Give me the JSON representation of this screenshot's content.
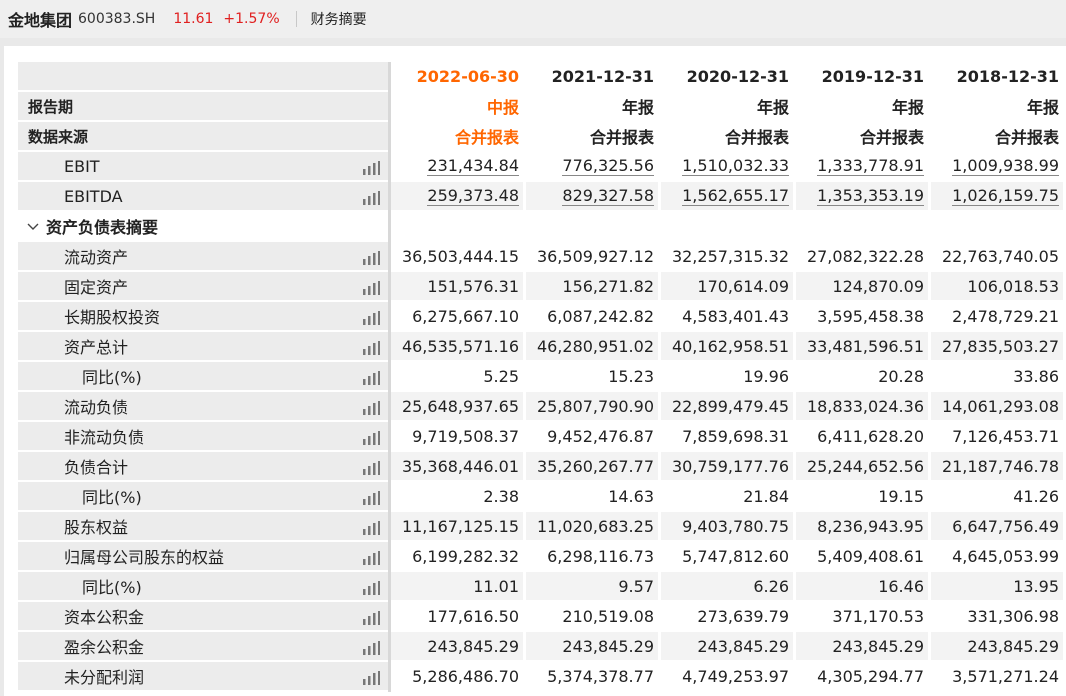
{
  "header": {
    "company": "金地集团",
    "code": "600383.SH",
    "price": "11.61",
    "change": "+1.57%",
    "tab": "财务摘要"
  },
  "columns": [
    {
      "date": "2022-06-30",
      "type": "中报",
      "source": "合并报表"
    },
    {
      "date": "2021-12-31",
      "type": "年报",
      "source": "合并报表"
    },
    {
      "date": "2020-12-31",
      "type": "年报",
      "source": "合并报表"
    },
    {
      "date": "2019-12-31",
      "type": "年报",
      "source": "合并报表"
    },
    {
      "date": "2018-12-31",
      "type": "年报",
      "source": "合并报表"
    }
  ],
  "labels": {
    "period": "报告期",
    "source": "数据来源",
    "section_balance": "资产负债表摘要"
  },
  "rows": [
    {
      "label": "EBIT",
      "values": [
        "231,434.84",
        "776,325.56",
        "1,510,032.33",
        "1,333,778.91",
        "1,009,938.99"
      ]
    },
    {
      "label": "EBITDA",
      "values": [
        "259,373.48",
        "829,327.58",
        "1,562,655.17",
        "1,353,353.19",
        "1,026,159.75"
      ]
    },
    {
      "label": "流动资产",
      "values": [
        "36,503,444.15",
        "36,509,927.12",
        "32,257,315.32",
        "27,082,322.28",
        "22,763,740.05"
      ]
    },
    {
      "label": "固定资产",
      "values": [
        "151,576.31",
        "156,271.82",
        "170,614.09",
        "124,870.09",
        "106,018.53"
      ]
    },
    {
      "label": "长期股权投资",
      "values": [
        "6,275,667.10",
        "6,087,242.82",
        "4,583,401.43",
        "3,595,458.38",
        "2,478,729.21"
      ]
    },
    {
      "label": "资产总计",
      "values": [
        "46,535,571.16",
        "46,280,951.02",
        "40,162,958.51",
        "33,481,596.51",
        "27,835,503.27"
      ]
    },
    {
      "label": "同比(%)",
      "values": [
        "5.25",
        "15.23",
        "19.96",
        "20.28",
        "33.86"
      ]
    },
    {
      "label": "流动负债",
      "values": [
        "25,648,937.65",
        "25,807,790.90",
        "22,899,479.45",
        "18,833,024.36",
        "14,061,293.08"
      ]
    },
    {
      "label": "非流动负债",
      "values": [
        "9,719,508.37",
        "9,452,476.87",
        "7,859,698.31",
        "6,411,628.20",
        "7,126,453.71"
      ]
    },
    {
      "label": "负债合计",
      "values": [
        "35,368,446.01",
        "35,260,267.77",
        "30,759,177.76",
        "25,244,652.56",
        "21,187,746.78"
      ]
    },
    {
      "label": "同比(%)",
      "values": [
        "2.38",
        "14.63",
        "21.84",
        "19.15",
        "41.26"
      ]
    },
    {
      "label": "股东权益",
      "values": [
        "11,167,125.15",
        "11,020,683.25",
        "9,403,780.75",
        "8,236,943.95",
        "6,647,756.49"
      ]
    },
    {
      "label": "归属母公司股东的权益",
      "values": [
        "6,199,282.32",
        "6,298,116.73",
        "5,747,812.60",
        "5,409,408.61",
        "4,645,053.99"
      ]
    },
    {
      "label": "同比(%)",
      "values": [
        "11.01",
        "9.57",
        "6.26",
        "16.46",
        "13.95"
      ]
    },
    {
      "label": "资本公积金",
      "values": [
        "177,616.50",
        "210,519.08",
        "273,639.79",
        "371,170.53",
        "331,306.98"
      ]
    },
    {
      "label": "盈余公积金",
      "values": [
        "243,845.29",
        "243,845.29",
        "243,845.29",
        "243,845.29",
        "243,845.29"
      ]
    },
    {
      "label": "未分配利润",
      "values": [
        "5,286,486.70",
        "5,374,378.77",
        "4,749,253.97",
        "4,305,294.77",
        "3,571,271.24"
      ]
    }
  ]
}
